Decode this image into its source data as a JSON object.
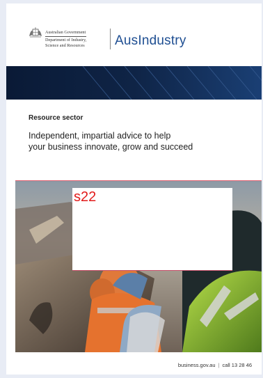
{
  "header": {
    "crest": "commonwealth-coat-of-arms",
    "gov_name": "Australian Government",
    "department_line1": "Department of Industry,",
    "department_line2": "Science and Resources",
    "brand": "AusIndustry"
  },
  "section": {
    "kicker": "Resource sector",
    "tagline_line1": "Independent, impartial advice to help",
    "tagline_line2": "your business innovate, grow and succeed"
  },
  "redaction": {
    "label": "s22"
  },
  "footer": {
    "website": "business.gov.au",
    "separator": "|",
    "phone": "call 13 28 46"
  },
  "colors": {
    "brand_blue": "#1e4e92",
    "band_navy": "#0d1e3d",
    "redaction_red": "#e21a1a"
  }
}
